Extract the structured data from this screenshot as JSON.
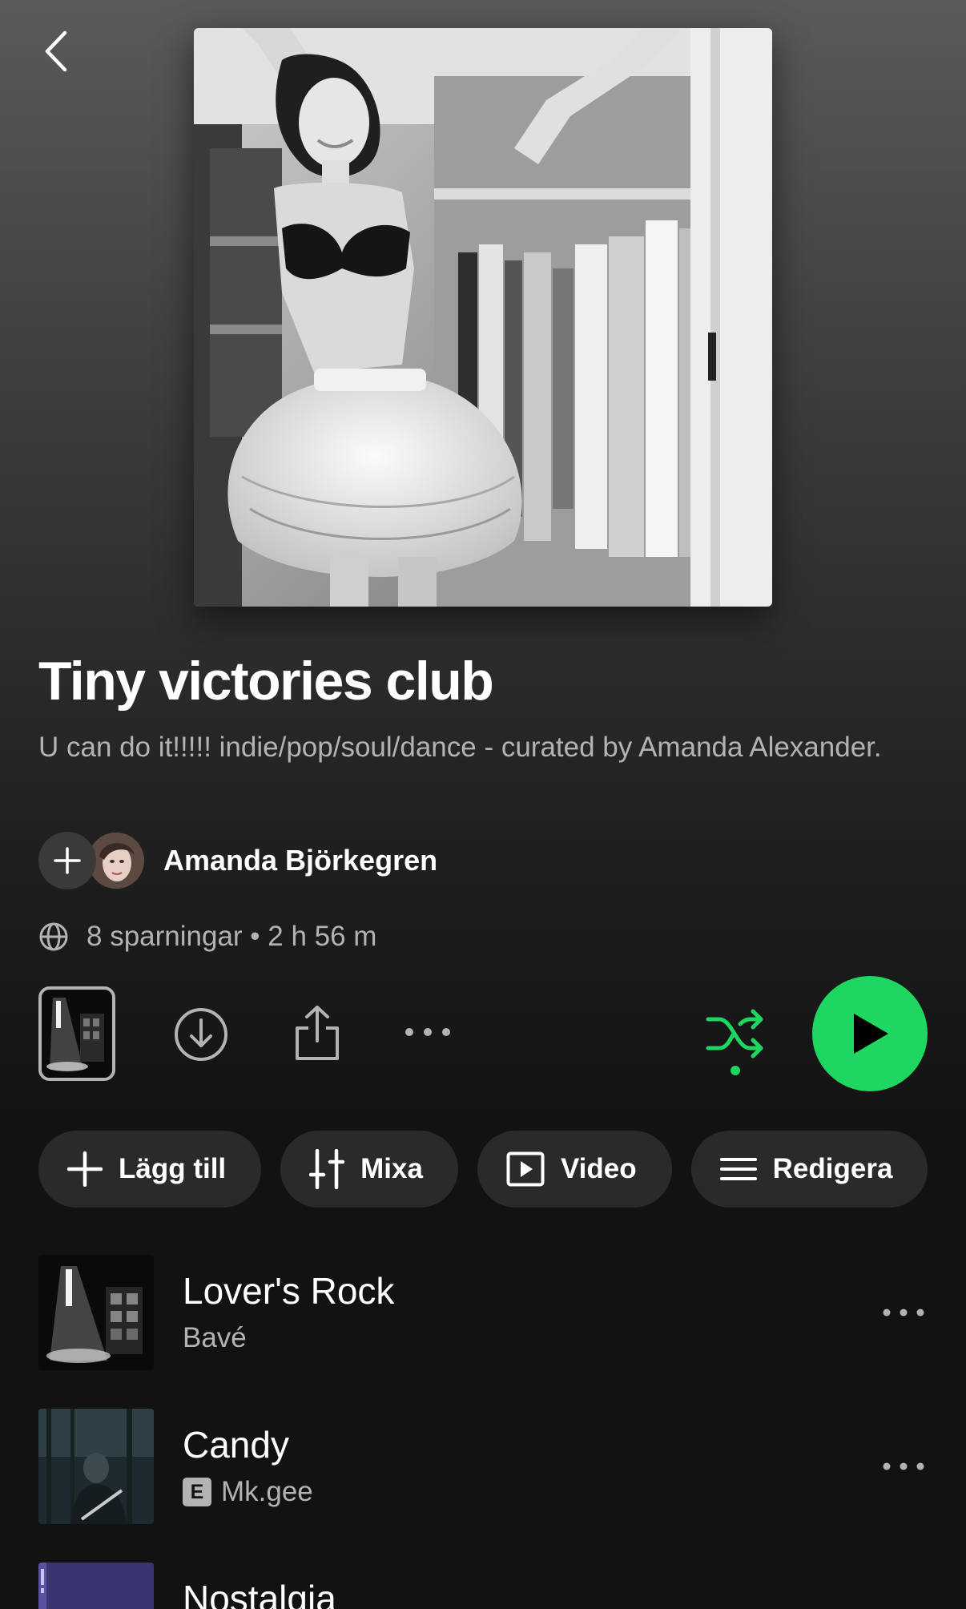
{
  "playlist": {
    "title": "Tiny victories club",
    "description": "U can do it!!!!! indie/pop/soul/dance - curated by Amanda Alexander.",
    "owner": "Amanda Björkegren",
    "meta": "8 sparningar • 2 h 56 m"
  },
  "actions": [
    {
      "label": "Lägg till",
      "icon": "plus-icon"
    },
    {
      "label": "Mixa",
      "icon": "sliders-icon"
    },
    {
      "label": "Video",
      "icon": "video-icon"
    },
    {
      "label": "Redigera",
      "icon": "list-icon"
    }
  ],
  "tracks": [
    {
      "title": "Lover's Rock",
      "artist": "Bavé",
      "explicit": false
    },
    {
      "title": "Candy",
      "artist": "Mk.gee",
      "explicit": true,
      "explicit_label": "E"
    },
    {
      "title": "Nostalgia"
    }
  ],
  "colors": {
    "accent": "#1ed760",
    "background": "#121212",
    "secondary_text": "#b3b3b3",
    "chip": "#2a2a2a"
  },
  "icons": {
    "back": "chevron-left-icon",
    "download": "download-icon",
    "share": "share-icon",
    "more": "more-horizontal-icon",
    "shuffle": "shuffle-icon",
    "play": "play-icon",
    "globe": "globe-icon"
  }
}
